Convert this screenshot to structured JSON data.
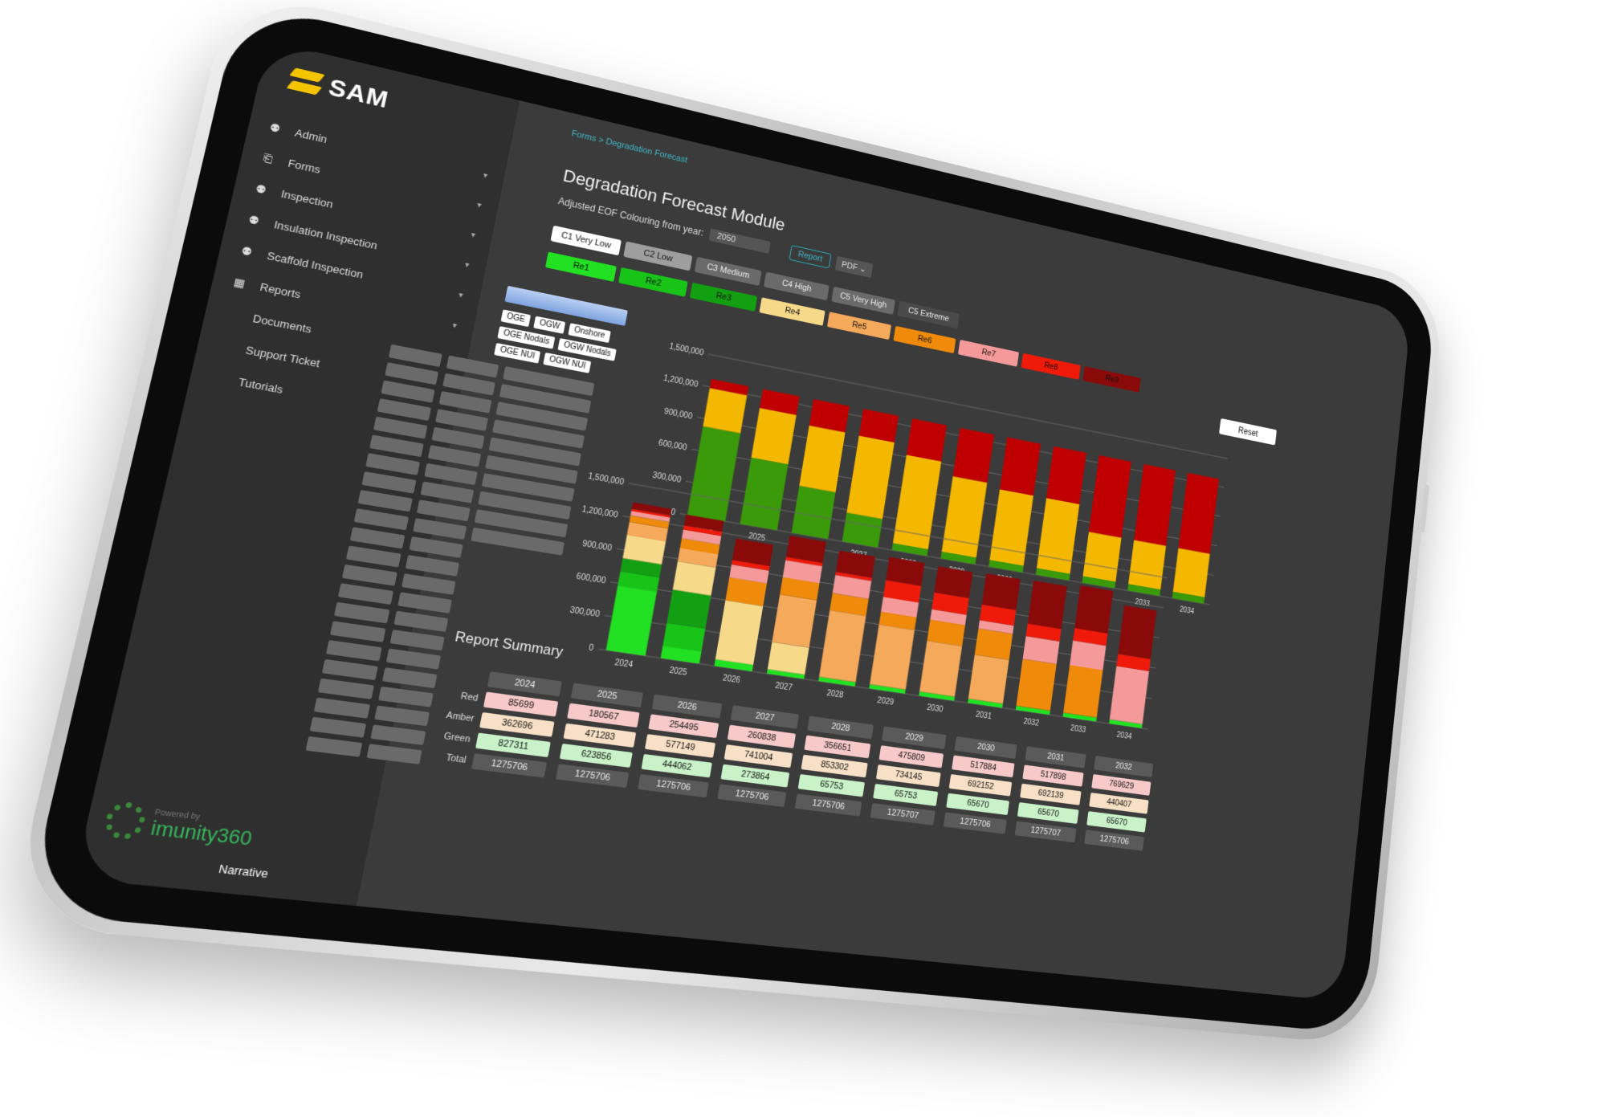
{
  "app": {
    "name": "SAM"
  },
  "sidebar": {
    "items": [
      {
        "label": "Admin",
        "icon": "users-icon",
        "chevron": true
      },
      {
        "label": "Forms",
        "icon": "document-icon",
        "chevron": true
      },
      {
        "label": "Inspection",
        "icon": "users-icon",
        "chevron": true
      },
      {
        "label": "Insulation Inspection",
        "icon": "users-icon",
        "chevron": true
      },
      {
        "label": "Scaffold Inspection",
        "icon": "users-icon",
        "chevron": true
      },
      {
        "label": "Reports",
        "icon": "table-icon",
        "chevron": true
      },
      {
        "label": "Documents",
        "icon": "",
        "chevron": false
      },
      {
        "label": "Support Ticket",
        "icon": "",
        "chevron": false
      },
      {
        "label": "Tutorials",
        "icon": "",
        "chevron": false
      }
    ],
    "powered_small": "Powered by",
    "powered_brand": "imunity360"
  },
  "breadcrumb": "Forms > Degradation Forecast",
  "page_title": "Degradation Forecast Module",
  "year_label": "Adjusted EOF Colouring from year:",
  "year_value": "2050",
  "report_button": "Report",
  "export_select": "PDF",
  "reset_button": "Reset",
  "narrative": "Narrative",
  "consequence_chips": [
    {
      "label": "C1 Very Low",
      "color": "#ffffff"
    },
    {
      "label": "C2 Low",
      "color": "#9e9e9e"
    },
    {
      "label": "C3 Medium",
      "color": "#6a6a6a"
    },
    {
      "label": "C4 High",
      "color": "#6a6a6a"
    },
    {
      "label": "C5 Very High",
      "color": "#6a6a6a"
    },
    {
      "label": "C5 Extreme",
      "color": "#4a4a4a"
    }
  ],
  "risk_chips": [
    {
      "label": "Re1",
      "color": "#22e022"
    },
    {
      "label": "Re2",
      "color": "#18c418"
    },
    {
      "label": "Re3",
      "color": "#12a012"
    },
    {
      "label": "Re4",
      "color": "#f7d98a"
    },
    {
      "label": "Re5",
      "color": "#f5a95a"
    },
    {
      "label": "Re6",
      "color": "#ef8a0a"
    },
    {
      "label": "Re7",
      "color": "#f59a9a"
    },
    {
      "label": "Re8",
      "color": "#f01a0a"
    },
    {
      "label": "Re9",
      "color": "#8a0a0a"
    }
  ],
  "filters": [
    "OGE",
    "OGW",
    "Onshore",
    "OGE Nodals",
    "OGW Nodals",
    "OGE NUI",
    "OGW NUI"
  ],
  "chart_data": [
    {
      "type": "bar",
      "stacked": true,
      "categories": [
        "2024",
        "2025",
        "2026",
        "2027",
        "2028",
        "2029",
        "2030",
        "2031",
        "2032",
        "2033",
        "2034"
      ],
      "yticks": [
        "1,500,000",
        "1,200,000",
        "900,000",
        "600,000",
        "300,000",
        "0"
      ],
      "ylim": [
        0,
        1500000
      ],
      "series": [
        {
          "color": "#3a9a0a",
          "values": [
            827311,
            623856,
            444062,
            273864,
            65753,
            65753,
            65670,
            65670,
            65670,
            65670,
            65670
          ]
        },
        {
          "color": "#f5b800",
          "values": [
            362696,
            471283,
            577149,
            741004,
            853302,
            734145,
            692152,
            692139,
            440407,
            440407,
            440407
          ]
        },
        {
          "color": "#c00000",
          "values": [
            85699,
            180567,
            254495,
            260838,
            356651,
            475809,
            517884,
            517898,
            769629,
            769629,
            769629
          ]
        }
      ]
    },
    {
      "type": "bar",
      "stacked": true,
      "categories": [
        "2024",
        "2025",
        "2026",
        "2027",
        "2028",
        "2029",
        "2030",
        "2031",
        "2032",
        "2033",
        "2034"
      ],
      "yticks": [
        "1,500,000",
        "1,200,000",
        "900,000",
        "600,000",
        "300,000",
        "0"
      ],
      "ylim": [
        0,
        1500000
      ],
      "series": [
        {
          "color": "#22e022",
          "values": [
            580000,
            110000,
            60000,
            40000,
            40000,
            40000,
            40000,
            40000,
            40000,
            40000,
            40000
          ]
        },
        {
          "color": "#18c418",
          "values": [
            130000,
            210000,
            0,
            0,
            0,
            0,
            0,
            0,
            0,
            0,
            0
          ]
        },
        {
          "color": "#12a012",
          "values": [
            117000,
            300000,
            0,
            0,
            0,
            0,
            0,
            0,
            0,
            0,
            0
          ]
        },
        {
          "color": "#f7d98a",
          "values": [
            210000,
            260000,
            540000,
            250000,
            0,
            0,
            0,
            0,
            0,
            0,
            0
          ]
        },
        {
          "color": "#f5a95a",
          "values": [
            120000,
            120000,
            0,
            440000,
            620000,
            560000,
            480000,
            420000,
            0,
            0,
            0
          ]
        },
        {
          "color": "#ef8a0a",
          "values": [
            60000,
            90000,
            210000,
            160000,
            160000,
            120000,
            200000,
            250000,
            450000,
            460000,
            0
          ]
        },
        {
          "color": "#f59a9a",
          "values": [
            40000,
            80000,
            120000,
            160000,
            170000,
            140000,
            100000,
            80000,
            220000,
            240000,
            520000
          ]
        },
        {
          "color": "#f01a0a",
          "values": [
            20000,
            40000,
            40000,
            30000,
            30000,
            160000,
            160000,
            150000,
            120000,
            120000,
            120000
          ]
        },
        {
          "color": "#8a0a0a",
          "values": [
            60000,
            100000,
            200000,
            200000,
            200000,
            220000,
            250000,
            300000,
            420000,
            420000,
            480000
          ]
        }
      ]
    }
  ],
  "summary": {
    "title": "Report Summary",
    "row_labels": [
      "Red",
      "Amber",
      "Green",
      "Total"
    ],
    "years": [
      "2024",
      "2025",
      "2026",
      "2027",
      "2028",
      "2029",
      "2030",
      "2031",
      "2032"
    ],
    "red": [
      "85699",
      "180567",
      "254495",
      "260838",
      "356651",
      "475809",
      "517884",
      "517898",
      "769629"
    ],
    "amber": [
      "362696",
      "471283",
      "577149",
      "741004",
      "853302",
      "734145",
      "692152",
      "692139",
      "440407"
    ],
    "green": [
      "827311",
      "623856",
      "444062",
      "273864",
      "65753",
      "65753",
      "65670",
      "65670",
      "65670"
    ],
    "total": [
      "1275706",
      "1275706",
      "1275706",
      "1275706",
      "1275706",
      "1275707",
      "1275706",
      "1275707",
      "1275706"
    ]
  }
}
